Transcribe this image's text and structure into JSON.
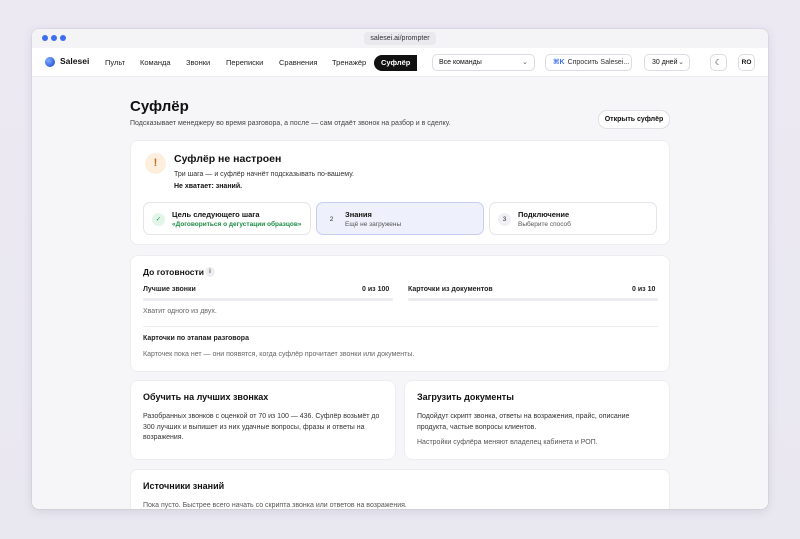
{
  "browser": {
    "url": "salesei.ai/prompter"
  },
  "nav": {
    "brand": "Salesei",
    "links": [
      "Пульт",
      "Команда",
      "Звонки",
      "Переписки",
      "Сравнения",
      "Тренажёр"
    ],
    "active": "Суфлёр",
    "team_select": "Все команды",
    "ask_shortcut": "⌘K",
    "ask_label": "Спросить Salesei...",
    "period": "30 дней",
    "avatar": "RO"
  },
  "header": {
    "title": "Суфлёр",
    "subtitle": "Подсказывает менеджеру во время разговора, а после — сам отдаёт звонок на разбор и в сделку.",
    "open_button": "Открыть суфлёр"
  },
  "setup": {
    "icon": "!",
    "title": "Суфлёр не настроен",
    "subtitle": "Три шага — и суфлёр начнёт подсказывать по-вашему.",
    "missing": "Не хватает: знаний.",
    "steps": [
      {
        "badge": "✓",
        "title": "Цель следующего шага",
        "sub": "«Договориться о дегустации образцов»",
        "state": "done"
      },
      {
        "badge": "2",
        "title": "Знания",
        "sub": "Ещё не загружены",
        "state": "current"
      },
      {
        "badge": "3",
        "title": "Подключение",
        "sub": "Выберите способ",
        "state": "todo"
      }
    ]
  },
  "readiness": {
    "title": "До готовности",
    "info": "i",
    "best_calls": {
      "label": "Лучшие звонки",
      "value": "0 из 100",
      "progress": 0
    },
    "doc_cards": {
      "label": "Карточки из документов",
      "value": "0 из 10",
      "progress": 0
    },
    "hint": "Хватит одного из двух.",
    "stage_label": "Карточки по этапам разговора",
    "stage_text": "Карточек пока нет — они появятся, когда суфлёр прочитает звонки или документы."
  },
  "train": {
    "title": "Обучить на лучших звонках",
    "text": [
      "Разобранных звонков с оценкой от 70 из 100 — 436. Суфлёр возьмёт до",
      "300 лучших и выпишет из них удачные вопросы, фразы и ответы на",
      "возражения."
    ]
  },
  "upload": {
    "title": "Загрузить документы",
    "text": [
      "Подойдут скрипт звонка, ответы на возражения, прайс, описание",
      "продукта, частые вопросы клиентов."
    ],
    "note": "Настройки суфлёра меняют владелец кабинета и РОП."
  },
  "sources": {
    "title": "Источники знаний",
    "text": "Пока пусто. Быстрее всего начать со скрипта звонка или ответов на возражения."
  },
  "colors": {
    "accent": "#3d6ef0",
    "success": "#1d8a44",
    "warning": "#c07020"
  }
}
